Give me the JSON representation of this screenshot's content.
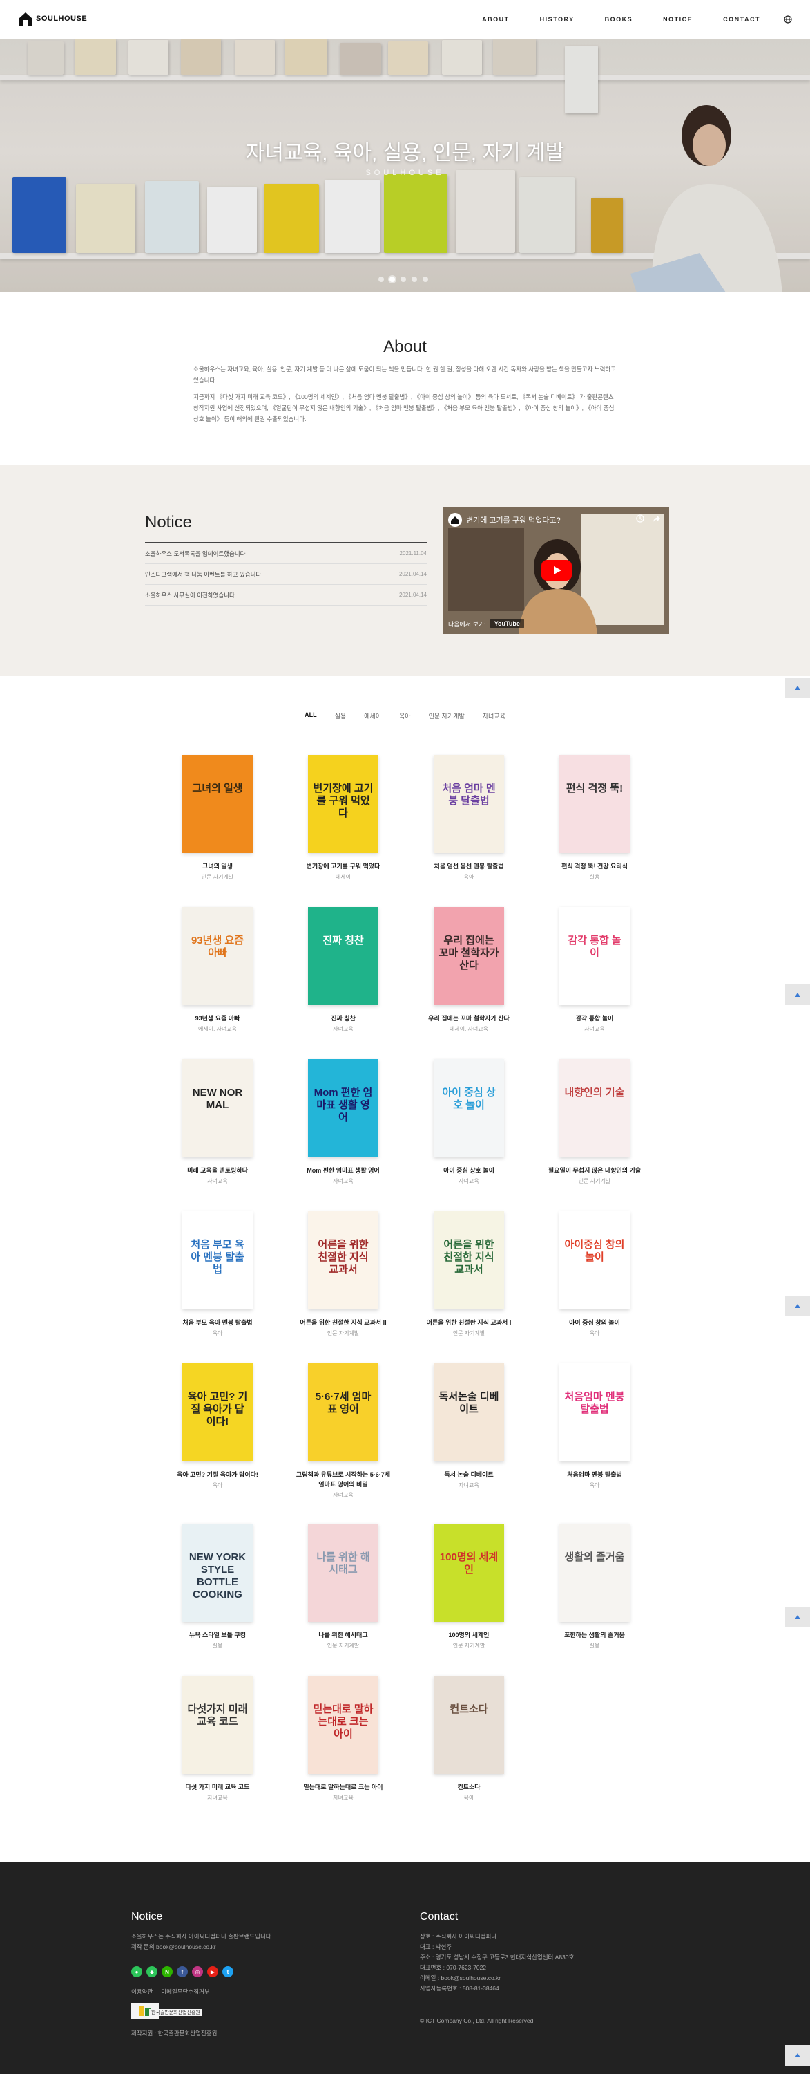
{
  "header": {
    "logo": "SOULHOUSE",
    "nav": [
      "ABOUT",
      "HISTORY",
      "BOOKS",
      "NOTICE",
      "CONTACT"
    ]
  },
  "hero": {
    "title": "자녀교육, 육아, 실용, 인문, 자기 계발",
    "subtitle": "SOULHOUSE",
    "slides": 5,
    "active_slide": 2
  },
  "about": {
    "title": "About",
    "p1": "소울하우스는 자녀교육, 육아, 실용, 인문, 자기 계발 등 더 나은 삶에 도움이 되는 책을 만듭니다. 한 권 한 권, 정성을 다해 오랜 시간 독자와 사랑을 받는 책을 만들고자 노력하고 있습니다.",
    "p2": "지금까지 《다섯 가지 미래 교육 코드》, 《100명의 세계인》, 《처음 엄마 멘붕 탈출법》, 《아이 중심 창의 놀이》 등의 육아 도서로, 《독서 논술 디베이트》 가 출판콘텐츠 창작지원 사업에 선정되었으며, 《얼굴탄이 무섭지 않은 내향인의 기술》, 《처음 엄마 멘붕 탈출법》, 《처음 부모 육아 멘붕 탈출법》, 《아이 중심 창의 놀이》, 《아이 중심 상호 놀이》 등이 해외에 판권 수출되었습니다."
  },
  "notice": {
    "title": "Notice",
    "items": [
      {
        "text": "소울하우스 도서목록을 업데이트했습니다",
        "date": "2021.11.04"
      },
      {
        "text": "인스타그램에서 책 나눔 이벤트를 하고 있습니다",
        "date": "2021.04.14"
      },
      {
        "text": "소울하우스 사무실이 이전하였습니다",
        "date": "2021.04.14"
      }
    ],
    "video": {
      "title": "변기에 고기를 구워 먹었다고?",
      "watch_label": "다음에서 보기:",
      "yt_label": "YouTube"
    }
  },
  "filters": [
    "ALL",
    "실용",
    "에세이",
    "육아",
    "인문 자기계발",
    "자녀교육"
  ],
  "books": [
    {
      "title": "그녀의 일생",
      "cat": "인문 자기계발",
      "cover": "#f08a1c",
      "ink": "#3a2a12",
      "text": "그녀의 일생"
    },
    {
      "title": "변기장에 고기를 구워 먹었다",
      "cat": "에세이",
      "cover": "#f5d21e",
      "ink": "#222",
      "text": "변기장에 고기를 구워 먹었다"
    },
    {
      "title": "처음 엄선 음선 멘붕 탈출법",
      "cat": "육아",
      "cover": "#f6f0e4",
      "ink": "#6a3fa0",
      "text": "처음 엄마 멘붕 탈출법"
    },
    {
      "title": "편식 걱정 뚝! 건강 요리식",
      "cat": "실용",
      "cover": "#f7dfe2",
      "ink": "#333",
      "text": "편식 걱정 뚝!"
    },
    {
      "title": "93년생 요즘 아빠",
      "cat": "에세이, 자녀교육",
      "cover": "#f4f1ea",
      "ink": "#e0751c",
      "text": "93년생 요즘 아빠"
    },
    {
      "title": "진짜 칭찬",
      "cat": "자녀교육",
      "cover": "#1fb38a",
      "ink": "#ffffff",
      "text": "진짜 칭찬"
    },
    {
      "title": "우리 집에는 꼬마 철학자가 산다",
      "cat": "에세이, 자녀교육",
      "cover": "#f2a3ae",
      "ink": "#3a2a2a",
      "text": "우리 집에는 꼬마 철학자가 산다"
    },
    {
      "title": "감각 통합 놀이",
      "cat": "자녀교육",
      "cover": "#ffffff",
      "ink": "#e23a6a",
      "text": "감각 통합 놀이"
    },
    {
      "title": "미래 교육을 멘토링하다",
      "cat": "자녀교육",
      "cover": "#f6f2ea",
      "ink": "#222",
      "text": "NEW NOR MAL"
    },
    {
      "title": "Mom 편한 엄마표 생활 영어",
      "cat": "자녀교육",
      "cover": "#23b5d8",
      "ink": "#1a1a6a",
      "text": "Mom 편한 엄마표 생활 영어"
    },
    {
      "title": "아이 중심 상호 놀이",
      "cat": "자녀교육",
      "cover": "#f4f6f7",
      "ink": "#2a9ed8",
      "text": "아이 중심 상호 놀이"
    },
    {
      "title": "필요일이 무섭지 않은 내향인의 기술",
      "cat": "인문 자기계발",
      "cover": "#f8eeee",
      "ink": "#c04040",
      "text": "내향인의 기술"
    },
    {
      "title": "처음 부모 육아 멘붕 탈출법",
      "cat": "육아",
      "cover": "#ffffff",
      "ink": "#2a72c0",
      "text": "처음 부모 육아 멘붕 탈출법"
    },
    {
      "title": "어른을 위한 친절한 지식 교과서 II",
      "cat": "인문 자기계발",
      "cover": "#fbf4ea",
      "ink": "#a02a2a",
      "text": "어른을 위한 친절한 지식 교과서"
    },
    {
      "title": "어른을 위한 친절한 지식 교과서 I",
      "cat": "인문 자기계발",
      "cover": "#f6f4e4",
      "ink": "#2a6a3a",
      "text": "어른을 위한 친절한 지식 교과서"
    },
    {
      "title": "아이 중심 창의 놀이",
      "cat": "육아",
      "cover": "#ffffff",
      "ink": "#e0402a",
      "text": "아이중심 창의놀이"
    },
    {
      "title": "육아 고민? 기질 육아가 답이다!",
      "cat": "육아",
      "cover": "#f5d623",
      "ink": "#222",
      "text": "육아 고민? 기질 육아가 답이다!"
    },
    {
      "title": "그림책과 유튜브로 시작하는 5·6·7세 엄마표 영어의 비밀",
      "cat": "자녀교육",
      "cover": "#f8d02a",
      "ink": "#222",
      "text": "5·6·7세 엄마표 영어"
    },
    {
      "title": "독서 논술 디베이트",
      "cat": "자녀교육",
      "cover": "#f4e7d8",
      "ink": "#222",
      "text": "독서논술 디베이트"
    },
    {
      "title": "처음엄마 멘붕 탈출법",
      "cat": "육아",
      "cover": "#ffffff",
      "ink": "#e0307a",
      "text": "처음엄마 멘붕 탈출법"
    },
    {
      "title": "뉴욕 스타일 보틀 쿠킹",
      "cat": "실용",
      "cover": "#e8f1f4",
      "ink": "#2a3a4a",
      "text": "NEW YORK STYLE BOTTLE COOKING"
    },
    {
      "title": "나를 위한 해시태그",
      "cat": "인문 자기계발",
      "cover": "#f4d6d8",
      "ink": "#8a9ab0",
      "text": "나를 위한 해시태그"
    },
    {
      "title": "100명의 세계인",
      "cat": "인문 자기계발",
      "cover": "#c8e02a",
      "ink": "#d0302a",
      "text": "100명의 세계인"
    },
    {
      "title": "포한하는 생활의 즐거움",
      "cat": "실용",
      "cover": "#f6f4f1",
      "ink": "#555",
      "text": "생활의 즐거움"
    },
    {
      "title": "다섯 가지 미래 교육 코드",
      "cat": "자녀교육",
      "cover": "#f6f1e4",
      "ink": "#333",
      "text": "다섯가지 미래교육 코드"
    },
    {
      "title": "믿는대로 말하는대로 크는 아이",
      "cat": "자녀교육",
      "cover": "#f8e2d6",
      "ink": "#c0282a",
      "text": "믿는대로 말하는대로 크는 아이"
    },
    {
      "title": "컨트소다",
      "cat": "육아",
      "cover": "#e8dfd6",
      "ink": "#6a5040",
      "text": "컨트소다"
    }
  ],
  "footer": {
    "notice_title": "Notice",
    "notice_text1": "소울하우스는 주식회사 아이씨티컴퍼니 출판브랜드입니다.",
    "notice_text2": "제작 문의 book@soulhouse.co.kr",
    "links": [
      "이용약관",
      "이메일무단수집거부"
    ],
    "badge_text": "한국출판문화산업진흥원",
    "support_text": "제작지원 : 한국출판문화산업진흥원",
    "contact_title": "Contact",
    "contact_lines": [
      "상호 : 주식회사 아이씨티컴퍼니",
      "대표 : 박현주",
      "주소 : 경기도 성남시 수정구 고등로3 현대지식산업센터 A830호",
      "대표번호 : 070-7623-7022",
      "이메일 : book@soulhouse.co.kr",
      "사업자등록번호 : 508-81-38464"
    ],
    "copyright": "© ICT Company Co., Ltd. All right Reserved."
  },
  "colors": {
    "accent": "#3a7bd5",
    "footer_bg": "#222222",
    "notice_bg": "#f2efeb"
  }
}
